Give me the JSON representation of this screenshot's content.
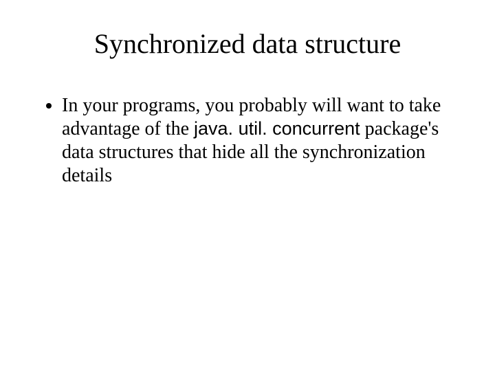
{
  "slide": {
    "title": "Synchronized data structure",
    "bullet": {
      "seg1": "In your programs, you probably will want to take advantage of the ",
      "code": "java. util. concurrent",
      "seg2": " package's data structures that hide all the synchronization details"
    }
  }
}
